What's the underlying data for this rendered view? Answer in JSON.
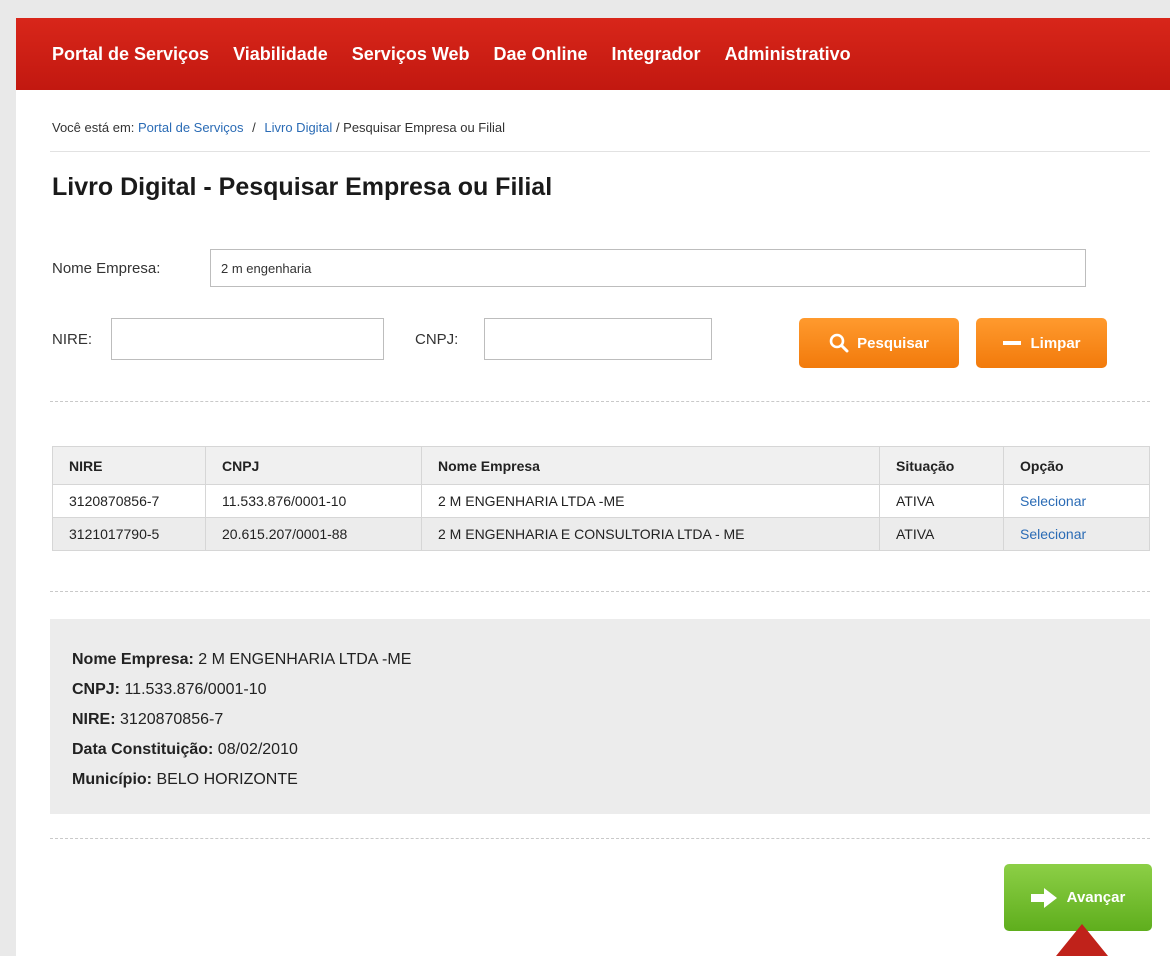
{
  "nav": {
    "items": [
      "Portal de Serviços",
      "Viabilidade",
      "Serviços Web",
      "Dae Online",
      "Integrador",
      "Administrativo"
    ]
  },
  "breadcrumb": {
    "prefix": "Você está em:",
    "crumbs": [
      "Portal de Serviços",
      "Livro Digital"
    ],
    "current": "/ Pesquisar Empresa ou Filial"
  },
  "page_title": "Livro Digital - Pesquisar Empresa ou Filial",
  "search": {
    "nome_label": "Nome Empresa:",
    "nome_value": "2 m engenharia",
    "nire_label": "NIRE:",
    "nire_value": "",
    "cnpj_label": "CNPJ:",
    "cnpj_value": "",
    "pesquisar_label": "Pesquisar",
    "limpar_label": "Limpar"
  },
  "table": {
    "headers": [
      "NIRE",
      "CNPJ",
      "Nome Empresa",
      "Situação",
      "Opção"
    ],
    "rows": [
      [
        "3120870856-7",
        "11.533.876/0001-10",
        "2 M ENGENHARIA LTDA -ME",
        "ATIVA",
        "Selecionar"
      ],
      [
        "3121017790-5",
        "20.615.207/0001-88",
        "2 M ENGENHARIA E CONSULTORIA LTDA - ME",
        "ATIVA",
        "Selecionar"
      ]
    ]
  },
  "details": [
    {
      "label": "Nome Empresa:",
      "value": "2 M ENGENHARIA LTDA -ME"
    },
    {
      "label": "CNPJ:",
      "value": "11.533.876/0001-10"
    },
    {
      "label": "NIRE:",
      "value": "3120870856-7"
    },
    {
      "label": "Data Constituição:",
      "value": "08/02/2010"
    },
    {
      "label": "Município:",
      "value": "BELO HORIZONTE"
    }
  ],
  "avancar_label": "Avançar",
  "colors": {
    "nav_red": "#c21810",
    "orange": "#f27a0b",
    "green": "#5fae1d",
    "link_blue": "#2a6bb5"
  },
  "icons": {
    "pesquisar": "search-icon",
    "limpar": "minus-icon",
    "avancar": "arrow-right-icon"
  }
}
